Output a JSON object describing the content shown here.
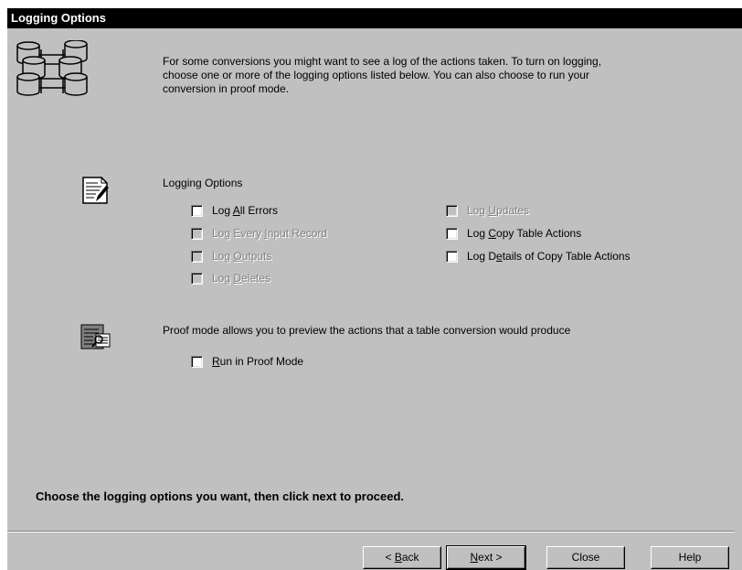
{
  "window": {
    "title": "Logging Options"
  },
  "intro": {
    "line1": "For some conversions you might want to see a log of the actions taken.  To turn on logging,",
    "line2": "choose one or more of the logging options listed below.  You can also choose to run your",
    "line3": "conversion in proof mode."
  },
  "logging": {
    "section_label": "Logging Options",
    "options": [
      {
        "pre": "Log ",
        "mn": "A",
        "post": "ll Errors",
        "enabled": true,
        "checked": false
      },
      {
        "pre": "Log Every ",
        "mn": "I",
        "post": "nput Record",
        "enabled": false,
        "checked": false
      },
      {
        "pre": "Log ",
        "mn": "O",
        "post": "utputs",
        "enabled": false,
        "checked": false
      },
      {
        "pre": "Log ",
        "mn": "D",
        "post": "eletes",
        "enabled": false,
        "checked": false
      },
      {
        "pre": "Log ",
        "mn": "U",
        "post": "pdates",
        "enabled": false,
        "checked": false
      },
      {
        "pre": "Log ",
        "mn": "C",
        "post": "opy Table Actions",
        "enabled": true,
        "checked": false
      },
      {
        "pre": "Log D",
        "mn": "e",
        "post": "tails of Copy Table Actions",
        "enabled": true,
        "checked": false
      }
    ]
  },
  "proof": {
    "description": "Proof mode allows you to preview the actions that a table conversion would produce",
    "option": {
      "pre": "",
      "mn": "R",
      "post": "un in Proof Mode",
      "enabled": true,
      "checked": false
    }
  },
  "instruction": "Choose the logging options you want, then click next to proceed.",
  "buttons": {
    "back": {
      "pre": "< ",
      "mn": "B",
      "post": "ack"
    },
    "next": {
      "pre": "",
      "mn": "N",
      "post": "ext >"
    },
    "close": "Close",
    "help": "Help"
  },
  "icons": {
    "header": "database-tables-icon",
    "logging": "notepad-pen-icon",
    "proof": "document-magnifier-icon"
  }
}
